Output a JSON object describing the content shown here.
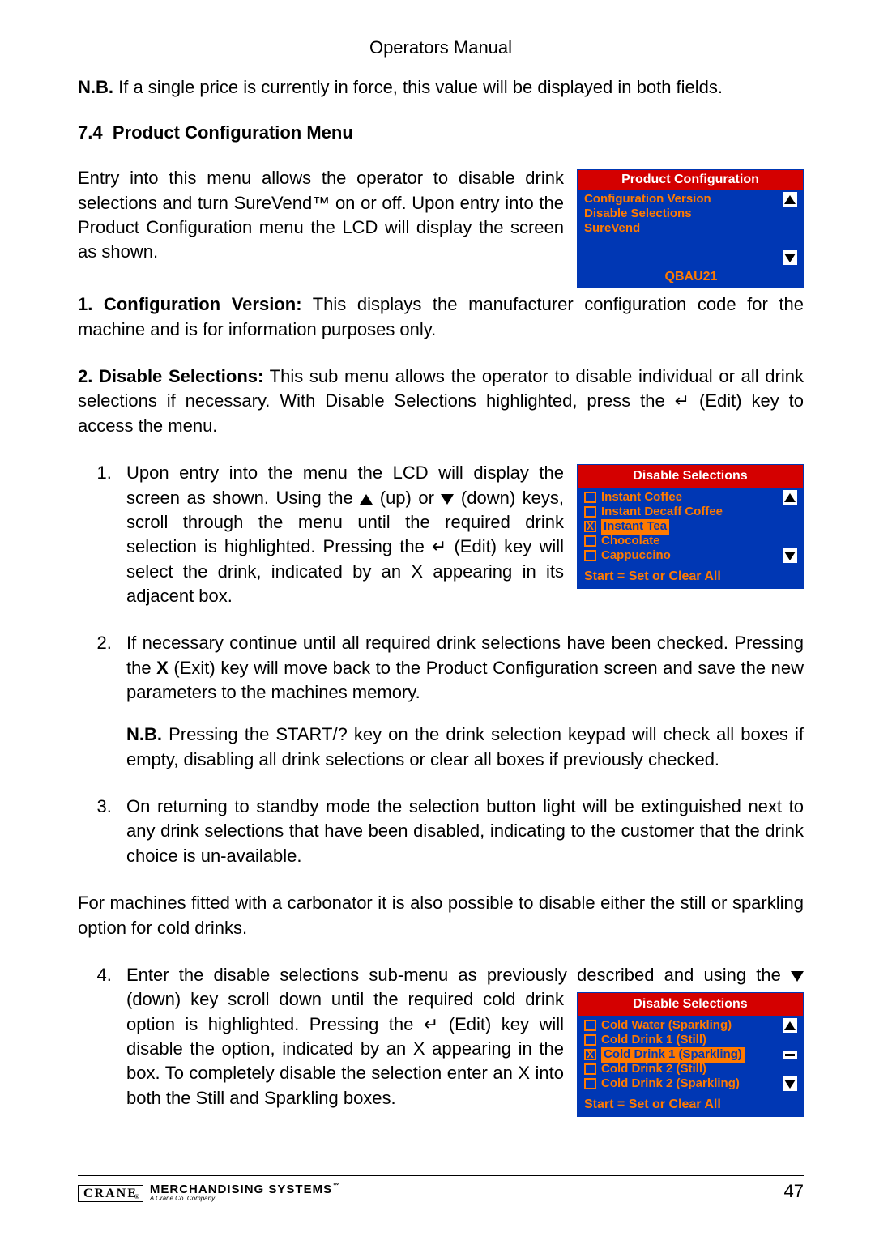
{
  "header": {
    "title": "Operators Manual"
  },
  "intro": {
    "nb_label": "N.B.",
    "nb_text": " If a single price is currently in force, this value will be displayed in both fields."
  },
  "section": {
    "number": "7.4",
    "title": "Product Configuration Menu"
  },
  "para_open": "Entry into this menu allows the operator to disable drink selections and turn SureVend™ on or off. Upon entry into the Product Configuration menu the LCD will display the screen as shown.",
  "lcd1": {
    "title": "Product Configuration",
    "items": [
      {
        "label": "Configuration Version",
        "hasBox": false,
        "checked": false,
        "highlight": false
      },
      {
        "label": "Disable Selections",
        "hasBox": false,
        "checked": false,
        "highlight": false
      },
      {
        "label": "SureVend",
        "hasBox": false,
        "checked": false,
        "highlight": false
      },
      {
        "label": "",
        "hasBox": false,
        "checked": false,
        "highlight": false
      },
      {
        "label": "",
        "hasBox": false,
        "checked": false,
        "highlight": false
      }
    ],
    "footer": "QBAU21",
    "footerCenter": true,
    "showMidBar": false
  },
  "para_cfgver_label": "1. Configuration Version:",
  "para_cfgver_text": " This displays the manufacturer configuration code for the machine and is for information purposes only.",
  "para_dissel_label": "2. Disable Selections:",
  "para_dissel_text": " This sub menu allows the operator to disable individual or all drink selections if necessary. With Disable Selections highlighted, press the ",
  "edit_key": " (Edit) key to access the menu.",
  "list": {
    "item1_a": "Upon entry into the menu the LCD will display the screen as shown. Using the ",
    "item1_b": " (up) or ",
    "item1_c": " (down) keys, scroll through the menu until the required drink selection is highlighted. Pressing the ",
    "item1_d": " (Edit) key will select the drink, indicated by an X appearing in its adjacent box.",
    "item2": "If necessary continue until all required drink selections have been checked. Pressing the ",
    "item2_b": " (Exit) key will move back to the Product Configuration screen and save the new parameters to the machines memory.",
    "item2_nb_label": "N.B.",
    "item2_nb": " Pressing the START/? key on the drink selection keypad will check all boxes if empty, disabling all drink selections or clear all boxes if previously checked.",
    "item3": "On returning to standby mode the selection button light will be extinguished next to any drink selections that have been disabled, indicating to the customer that the drink choice is un-available."
  },
  "lcd2": {
    "title": "Disable Selections",
    "items": [
      {
        "label": "Instant Coffee",
        "hasBox": true,
        "checked": false,
        "highlight": false
      },
      {
        "label": "Instant Decaff Coffee",
        "hasBox": true,
        "checked": false,
        "highlight": false
      },
      {
        "label": "Instant Tea",
        "hasBox": true,
        "checked": true,
        "highlight": true
      },
      {
        "label": "Chocolate",
        "hasBox": true,
        "checked": false,
        "highlight": false
      },
      {
        "label": "Cappuccino",
        "hasBox": true,
        "checked": false,
        "highlight": false
      }
    ],
    "footer": "Start = Set or Clear All",
    "footerCenter": false,
    "showMidBar": false
  },
  "para_carbonator": "For machines fitted with a carbonator it is also possible to disable either the still or sparkling option for cold drinks.",
  "list2": {
    "start": 4,
    "item4_a": "Enter the disable selections sub-menu as previously described and using the ",
    "item4_b": " (down) key scroll down until the required cold drink option is highlighted. Pressing the ",
    "item4_c": " (Edit) key will disable the option, indicated by an X appearing in the box. To completely disable the selection enter an X into both the Still and Sparkling boxes."
  },
  "lcd3": {
    "title": "Disable Selections",
    "items": [
      {
        "label": "Cold Water (Sparkling)",
        "hasBox": true,
        "checked": false,
        "highlight": false
      },
      {
        "label": "Cold Drink 1 (Still)",
        "hasBox": true,
        "checked": false,
        "highlight": false
      },
      {
        "label": "Cold Drink 1 (Sparkling)",
        "hasBox": true,
        "checked": true,
        "highlight": true
      },
      {
        "label": "Cold Drink 2 (Still)",
        "hasBox": true,
        "checked": false,
        "highlight": false
      },
      {
        "label": "Cold Drink 2 (Sparkling)",
        "hasBox": true,
        "checked": false,
        "highlight": false
      }
    ],
    "footer": "Start = Set or Clear All",
    "footerCenter": false,
    "showMidBar": true
  },
  "glyphs": {
    "enter": "↵",
    "exit": "X"
  },
  "footer": {
    "brand_box": "CRANE",
    "brand_reg": "®",
    "brand_ms": "MERCHANDISING SYSTEMS",
    "brand_tm": "™",
    "brand_sub": "A Crane Co. Company",
    "page": "47"
  }
}
